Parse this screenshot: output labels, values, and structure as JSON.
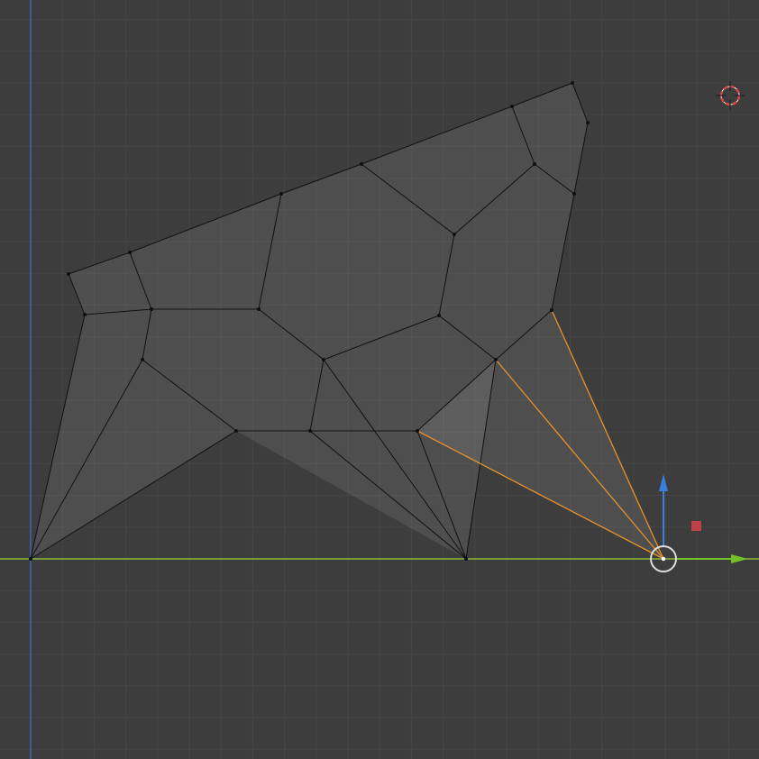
{
  "viewport": {
    "view": "front-orthographic",
    "background_color": "#3d3d3d",
    "grid": {
      "minor_color": "#454545",
      "major_color": "#4a4a4a"
    },
    "axes": {
      "x_axis_color": "#8ab634",
      "z_axis_color": "#3c63b8"
    },
    "mesh": {
      "face_color": "#ffffff",
      "face_opacity": 0.09,
      "edge_color": "#111111",
      "vertex_color": "#101010",
      "selected_edge_color": "#e8912b",
      "selected_vertex_color": "#ffffff"
    },
    "gizmo": {
      "x_arrow_color": "#74c22a",
      "z_arrow_color": "#3a7fe0",
      "plane_handle_color": "#c0404a",
      "center_ring_color": "#dddddd"
    },
    "cursor_3d": {
      "icon": "3d-cursor-icon",
      "ring_color": "#d94545"
    }
  }
}
